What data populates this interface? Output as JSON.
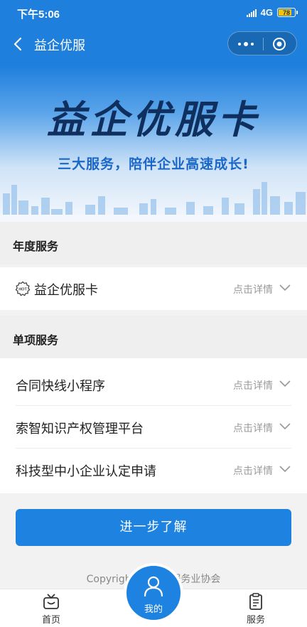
{
  "status": {
    "time": "下午5:06",
    "network": "4G",
    "battery": "78"
  },
  "nav": {
    "title": "益企优服"
  },
  "banner": {
    "brand": "益企优服卡",
    "slogan": "三大服务，陪伴企业高速成长!"
  },
  "annual": {
    "heading": "年度服务",
    "items": [
      {
        "label": "益企优服卡",
        "detail": "点击详情",
        "badge": "HOT"
      }
    ]
  },
  "single": {
    "heading": "单项服务",
    "items": [
      {
        "label": "合同快线小程序",
        "detail": "点击详情"
      },
      {
        "label": "索智知识产权管理平台",
        "detail": "点击详情"
      },
      {
        "label": "科技型中小企业认定申请",
        "detail": "点击详情"
      }
    ]
  },
  "cta": {
    "label": "进一步了解"
  },
  "footer": {
    "copyright": "Copyright © 2        代服务业协会"
  },
  "tabs": {
    "home": "首页",
    "mine": "我的",
    "service": "服务"
  },
  "colors": {
    "primary": "#1e82e0",
    "navy": "#0f2f5e"
  }
}
